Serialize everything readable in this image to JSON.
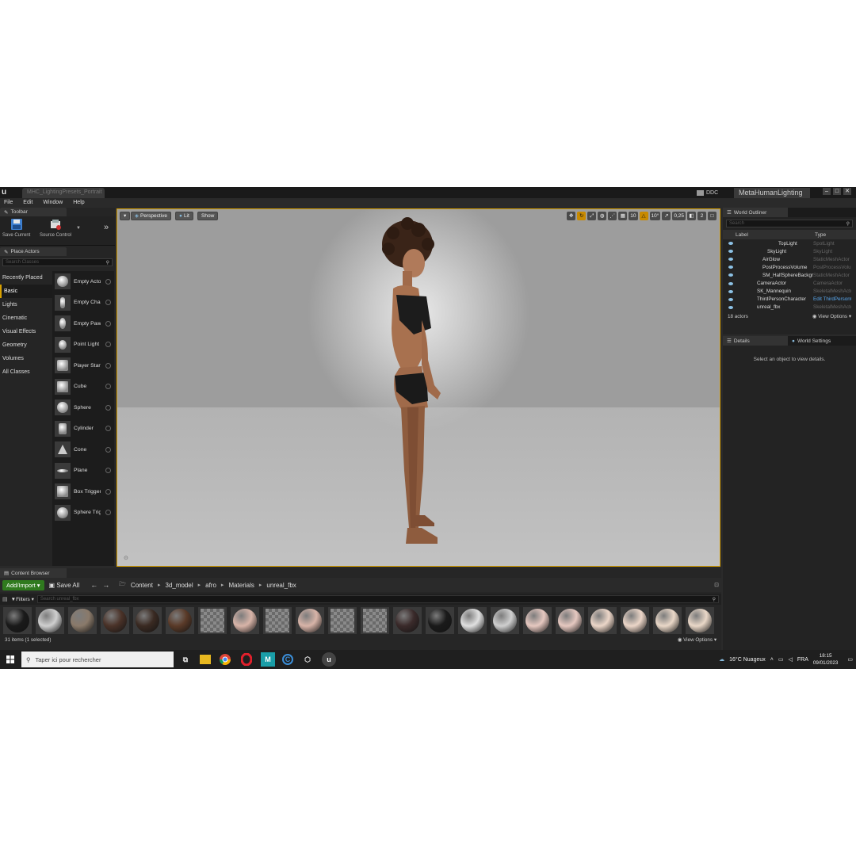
{
  "titlebar": {
    "tab": "MHC_LightingPresets_Portrait",
    "ddc": "DDC",
    "project": "MetaHumanLighting"
  },
  "menu": [
    "File",
    "Edit",
    "Window",
    "Help"
  ],
  "toolbar_panel": {
    "tab": "Toolbar",
    "save_current": "Save Current",
    "source_control": "Source Control"
  },
  "place_actors": {
    "tab": "Place Actors",
    "search_placeholder": "Search Classes",
    "categories": [
      "Recently Placed",
      "Basic",
      "Lights",
      "Cinematic",
      "Visual Effects",
      "Geometry",
      "Volumes",
      "All Classes"
    ],
    "items": [
      "Empty Actor",
      "Empty Character",
      "Empty Pawn",
      "Point Light",
      "Player Start",
      "Cube",
      "Sphere",
      "Cylinder",
      "Cone",
      "Plane",
      "Box Trigger",
      "Sphere Trigger"
    ]
  },
  "viewport": {
    "perspective": "Perspective",
    "lit": "Lit",
    "show": "Show",
    "grid_snap": "10",
    "rotation_snap": "10°",
    "scale_snap": "0,25",
    "camera_speed": "2"
  },
  "outliner": {
    "tab": "World Outliner",
    "search_placeholder": "Search",
    "col_label": "Label",
    "col_type": "Type",
    "rows": [
      {
        "name": "TopLight",
        "type": "SpotLight"
      },
      {
        "name": "SkyLight",
        "type": "SkyLight"
      },
      {
        "name": "AirGlow",
        "type": "StaticMeshActor"
      },
      {
        "name": "PostProcessVolume",
        "type": "PostProcessVolume"
      },
      {
        "name": "SM_HalfSphereBackground",
        "type": "StaticMeshActor"
      },
      {
        "name": "CameraActor",
        "type": "CameraActor"
      },
      {
        "name": "SK_Mannequin",
        "type": "SkeletalMeshActor"
      },
      {
        "name": "ThirdPersonCharacter",
        "type": "Edit ThirdPersonCharacter"
      },
      {
        "name": "unreal_fbx",
        "type": "SkeletalMeshActor"
      }
    ],
    "count": "18 actors",
    "view_options": "View Options"
  },
  "details": {
    "tab": "Details",
    "world_settings": "World Settings",
    "empty_message": "Select an object to view details."
  },
  "content_browser": {
    "tab": "Content Browser",
    "add_import": "Add/Import",
    "save_all": "Save All",
    "path": [
      "Content",
      "3d_model",
      "afro",
      "Materials",
      "unreal_fbx"
    ],
    "filters": "Filters",
    "search_placeholder": "Search unreal_fbx",
    "status": "31 items (1 selected)",
    "view_options": "View Options",
    "asset_colors": [
      "#1a1a1a",
      "#cfcfcf",
      "#8a7a6a",
      "#4a3228",
      "#3a2a22",
      "#5a3a28",
      "checker",
      "#d8b4a8",
      "checker",
      "#d8b4a8",
      "checker",
      "checker",
      "#3a2a2a",
      "#1a1a1a",
      "#e0e0e0",
      "#cfcfcf",
      "#e6c8c0",
      "#e6c8c0",
      "#ecd6c8",
      "#ecd6c8",
      "#ead8c8",
      "#ead8c8"
    ]
  },
  "taskbar": {
    "search": "Taper ici pour rechercher",
    "weather": "16°C Nuageux",
    "lang": "FRA",
    "time": "18:15",
    "date": "09/01/2023"
  }
}
